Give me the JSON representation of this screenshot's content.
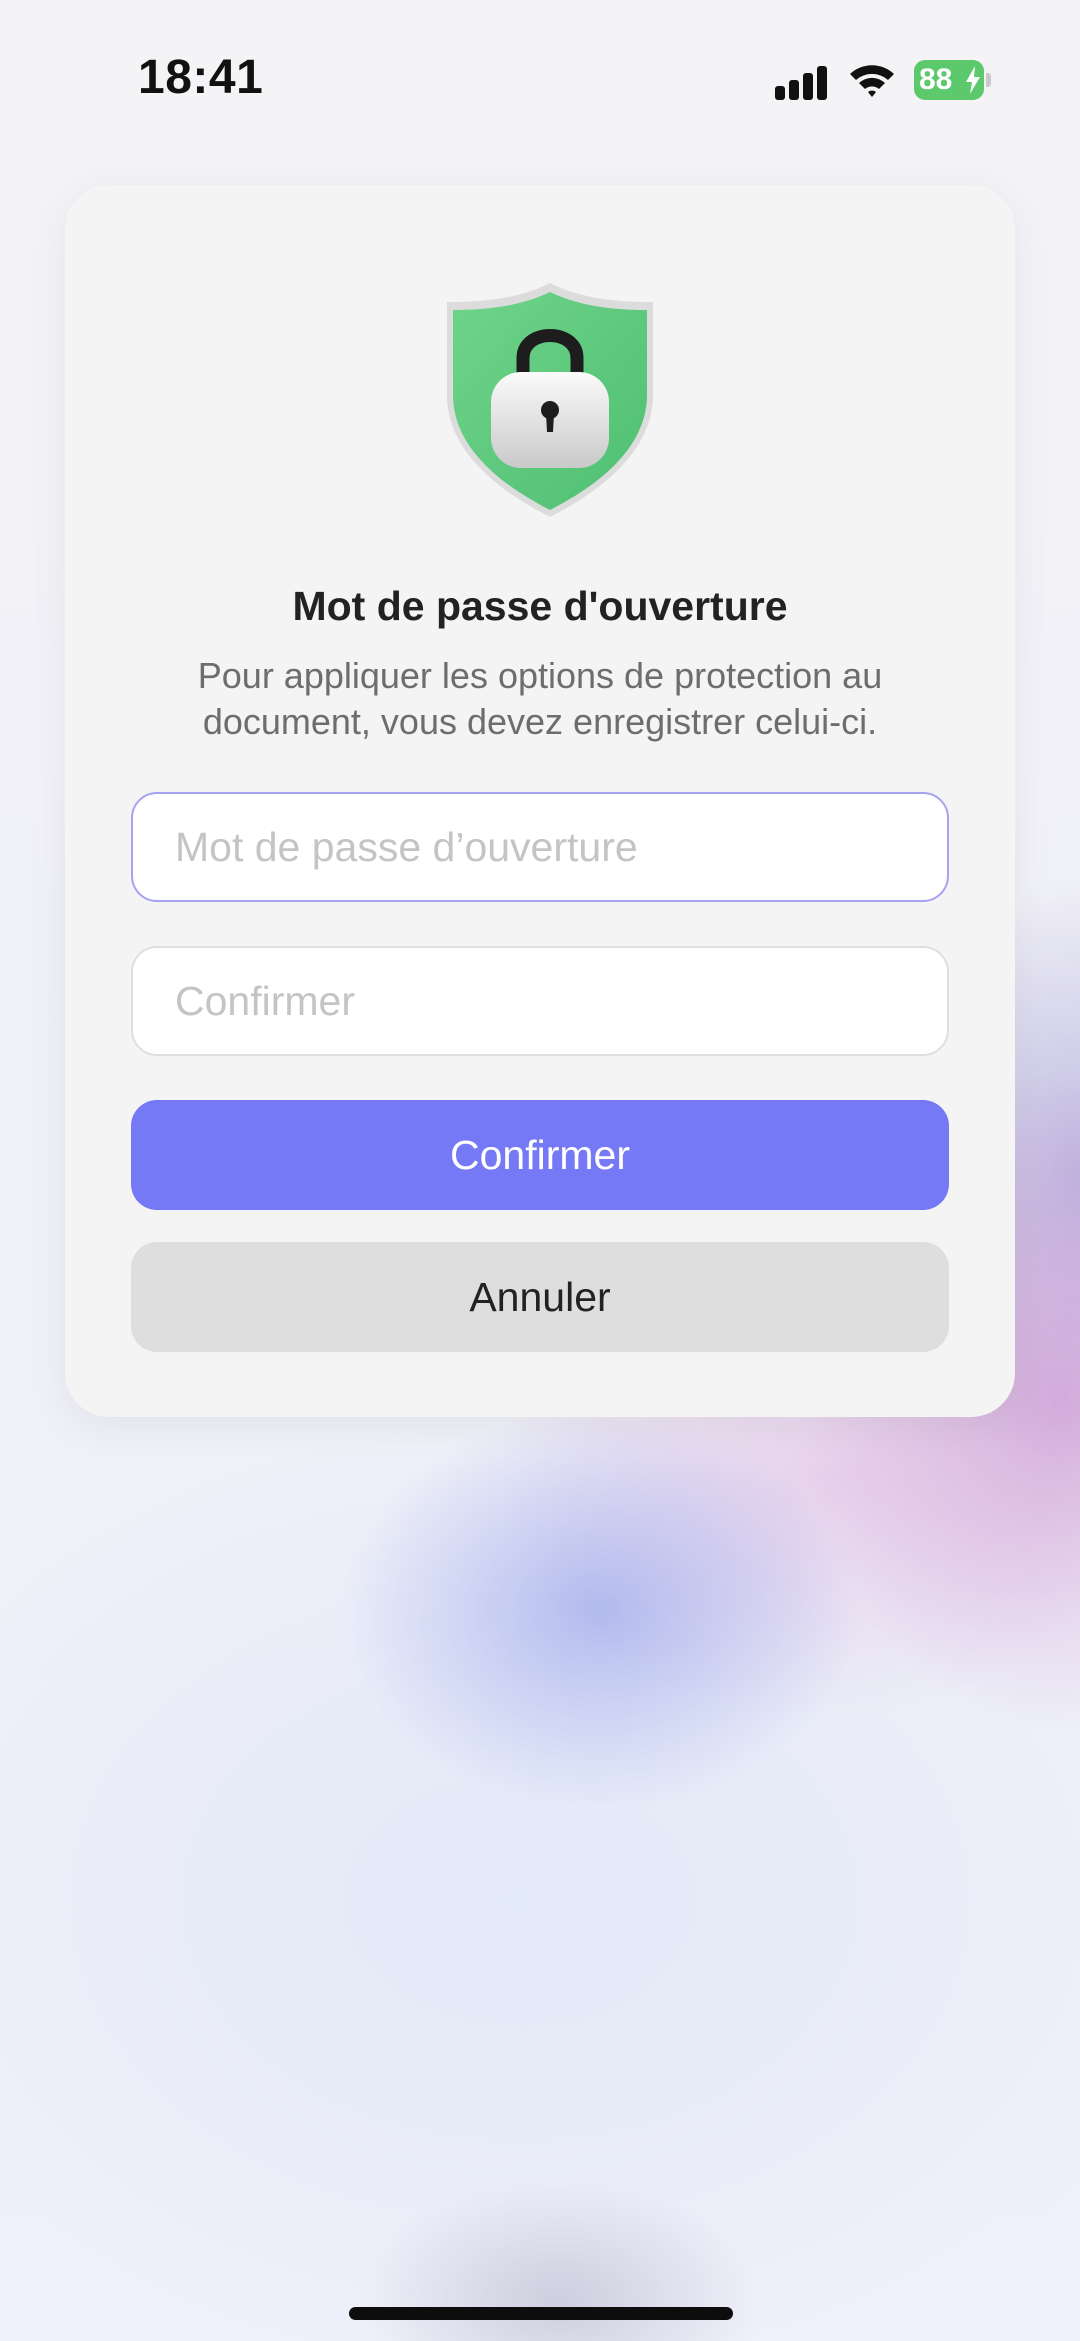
{
  "status_bar": {
    "time": "18:41",
    "battery_level": "88",
    "battery_color": "#5bc96c",
    "icons": [
      "signal-icon",
      "wifi-icon",
      "battery-charging-icon"
    ]
  },
  "dialog": {
    "title": "Mot de passe d'ouverture",
    "description": "Pour appliquer les options de protection au document, vous devez enregistrer celui-ci.",
    "illustration": "shield-lock-icon",
    "password_field": {
      "value": "",
      "placeholder": "Mot de passe d’ouverture"
    },
    "confirm_field": {
      "value": "",
      "placeholder": "Confirmer"
    },
    "confirm_button": "Confirmer",
    "cancel_button": "Annuler"
  },
  "colors": {
    "accent": "#7579f5",
    "shield_green": "#5fcf80",
    "cancel_bg": "#dedede",
    "dialog_bg": "#f4f4f4"
  }
}
